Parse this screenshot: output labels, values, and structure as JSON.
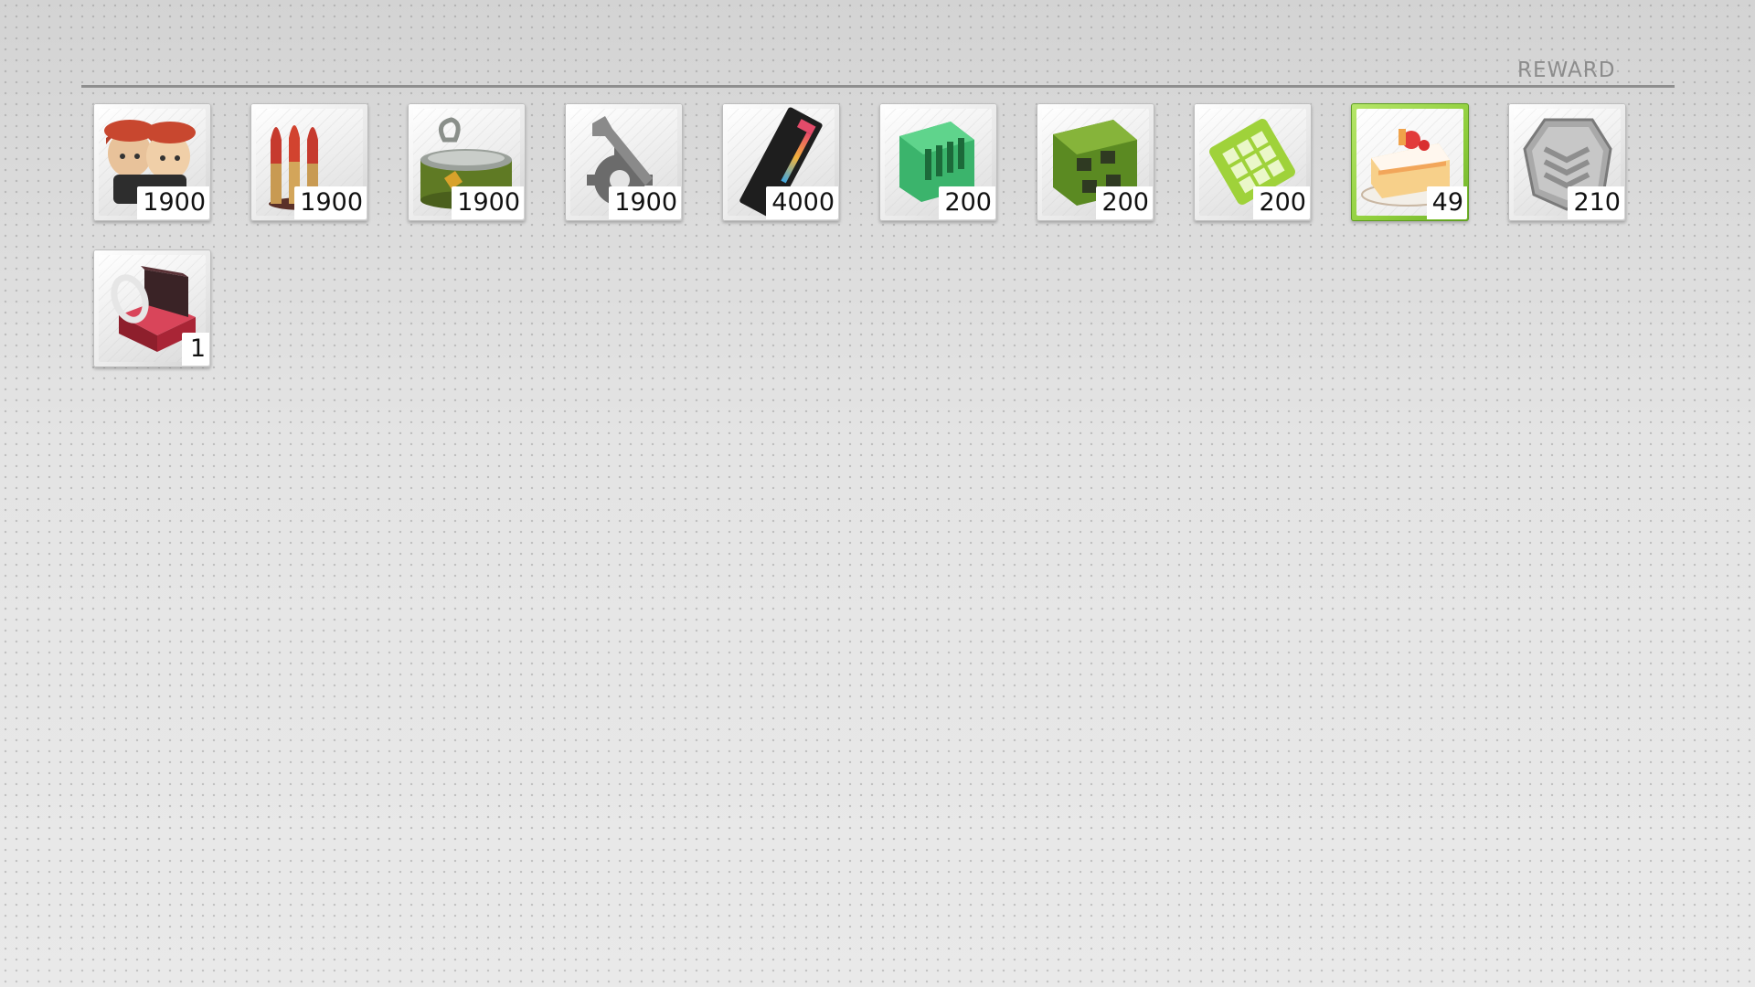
{
  "header": {
    "label": "REWARD"
  },
  "rewards": [
    {
      "name": "Manpower",
      "icon": "dolls-icon",
      "quantity": "1900",
      "tier": "grey"
    },
    {
      "name": "Ammo",
      "icon": "ammo-icon",
      "quantity": "1900",
      "tier": "grey"
    },
    {
      "name": "Rations",
      "icon": "ration-can-icon",
      "quantity": "1900",
      "tier": "grey"
    },
    {
      "name": "Parts",
      "icon": "wrench-gear-icon",
      "quantity": "1900",
      "tier": "grey"
    },
    {
      "name": "Ticket",
      "icon": "ticket-icon",
      "quantity": "4000",
      "tier": "grey"
    },
    {
      "name": "Data chip",
      "icon": "green-chip-icon",
      "quantity": "200",
      "tier": "grey"
    },
    {
      "name": "Circuit chip",
      "icon": "circuit-board-icon",
      "quantity": "200",
      "tier": "grey"
    },
    {
      "name": "Grid chip",
      "icon": "grid-chip-icon",
      "quantity": "200",
      "tier": "grey"
    },
    {
      "name": "Cake",
      "icon": "cake-icon",
      "quantity": "49",
      "tier": "green"
    },
    {
      "name": "Token",
      "icon": "token-icon",
      "quantity": "210",
      "tier": "grey"
    },
    {
      "name": "Oath ring",
      "icon": "ring-box-icon",
      "quantity": "1",
      "tier": "grey"
    }
  ]
}
